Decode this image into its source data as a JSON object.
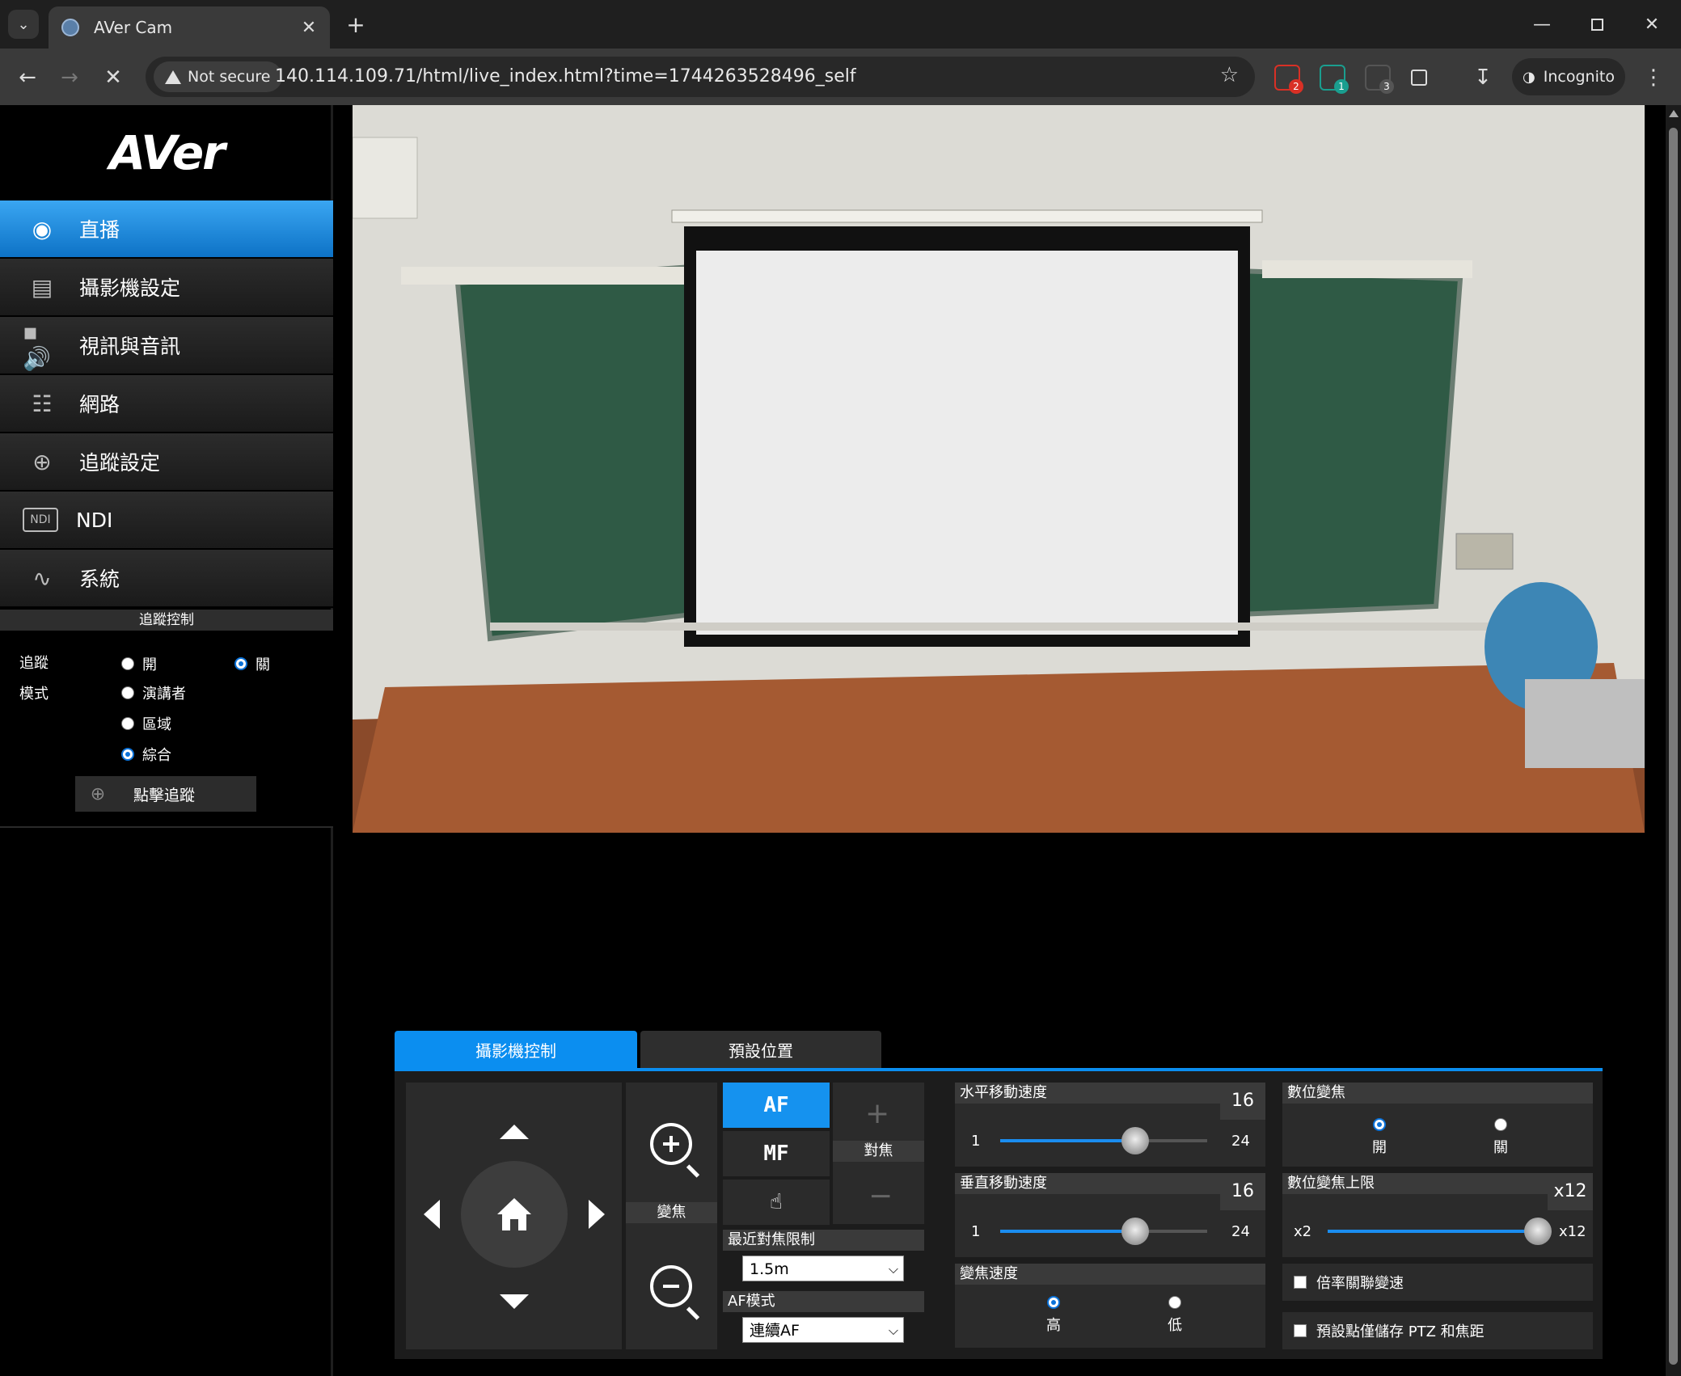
{
  "browser": {
    "tab_title": "AVer Cam",
    "security_label": "Not secure",
    "url": "140.114.109.71/html/live_index.html?time=1744263528496_self",
    "incognito_label": "Incognito",
    "extensions": [
      {
        "name": "ext-1",
        "badge": "2",
        "color": "#d93025"
      },
      {
        "name": "ext-2",
        "badge": "1",
        "color": "#1a9e8f"
      },
      {
        "name": "ext-3",
        "badge": "3",
        "color": "#555555"
      }
    ]
  },
  "brand": {
    "logo": "AVer"
  },
  "sidebar": {
    "items": [
      {
        "label": "直播",
        "icon": "eye-icon",
        "active": true
      },
      {
        "label": "攝影機設定",
        "icon": "image-icon",
        "active": false
      },
      {
        "label": "視訊與音訊",
        "icon": "video-audio-icon",
        "active": false
      },
      {
        "label": "網路",
        "icon": "network-icon",
        "active": false
      },
      {
        "label": "追蹤設定",
        "icon": "target-icon",
        "active": false
      },
      {
        "label": "NDI",
        "icon": "ndi-icon",
        "active": false
      },
      {
        "label": "系統",
        "icon": "pulse-icon",
        "active": false
      }
    ]
  },
  "tracking": {
    "title": "追蹤控制",
    "tracking_label": "追蹤",
    "on_label": "開",
    "off_label": "關",
    "tracking_state": "off",
    "mode_label": "模式",
    "modes": [
      "演講者",
      "區域",
      "綜合"
    ],
    "selected_mode": "綜合",
    "click_track_label": "點擊追蹤"
  },
  "control": {
    "tabs": [
      {
        "label": "攝影機控制",
        "active": true
      },
      {
        "label": "預設位置",
        "active": false
      }
    ],
    "zoom_label": "變焦",
    "focus_label": "對焦",
    "af_label": "AF",
    "mf_label": "MF",
    "near_focus_label": "最近對焦限制",
    "near_focus_value": "1.5m",
    "af_mode_label": "AF模式",
    "af_mode_value": "連續AF",
    "pan_speed": {
      "label": "水平移動速度",
      "value": 16,
      "min": 1,
      "max": 24
    },
    "tilt_speed": {
      "label": "垂直移動速度",
      "value": 16,
      "min": 1,
      "max": 24
    },
    "zoom_speed": {
      "label": "變焦速度",
      "high": "高",
      "low": "低",
      "selected": "high"
    },
    "digital_zoom": {
      "label": "數位變焦",
      "on": "開",
      "off": "關",
      "selected": "on"
    },
    "digital_zoom_limit": {
      "label": "數位變焦上限",
      "value_text": "x12",
      "min_text": "x2",
      "max_text": "x12",
      "min": 2,
      "max": 12,
      "value": 12
    },
    "ratio_speed_label": "倍率關聯變速",
    "preset_save_label": "預設點僅儲存 PTZ 和焦距"
  }
}
